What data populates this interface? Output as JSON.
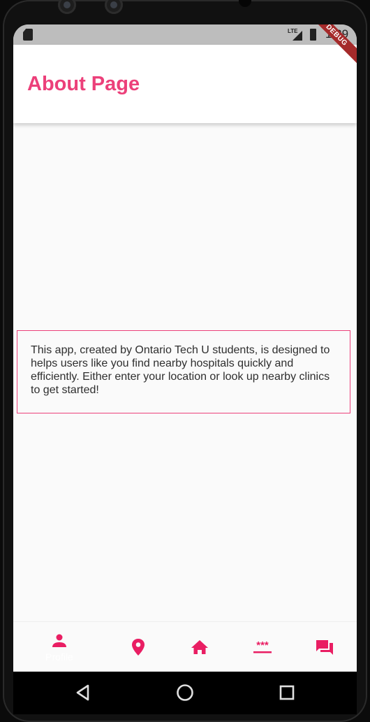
{
  "status_bar": {
    "network": "LTE",
    "time": "1:29"
  },
  "debug_banner": "DEBUG",
  "app_bar": {
    "title": "About Page"
  },
  "about": {
    "text": "This app, created by Ontario Tech U students, is designed to helps users like you find nearby hospitals quickly and efficiently. Either enter your location or look up nearby clinics to get started!"
  },
  "bottom_nav": {
    "accent_color": "#e91e63",
    "items": [
      {
        "icon": "person-icon",
        "label": "Profile",
        "selected": true
      },
      {
        "icon": "location-pin-icon",
        "label": ""
      },
      {
        "icon": "home-icon",
        "label": ""
      },
      {
        "icon": "password-icon",
        "label": ""
      },
      {
        "icon": "forum-icon",
        "label": ""
      }
    ]
  },
  "system_nav": {
    "buttons": [
      "back-icon",
      "home-circle-icon",
      "recents-icon"
    ]
  },
  "colors": {
    "primary": "#ec407a",
    "status_bar": "#bdbdbd",
    "background": "#fafafa"
  }
}
